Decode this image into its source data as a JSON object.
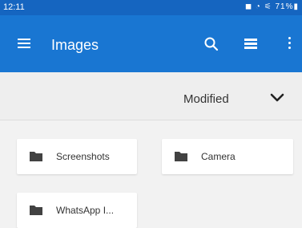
{
  "status_bar": {
    "time": "12:11",
    "icons_text": "◼ ◔ ⚟ 71%▮"
  },
  "app_bar": {
    "title": "Images",
    "menu_icon": "hamburger-menu-icon",
    "search_icon": "search-icon",
    "view_icon": "list-view-icon",
    "overflow_icon": "more-vert-icon"
  },
  "sort": {
    "label": "Modified"
  },
  "folders": [
    {
      "name": "Screenshots"
    },
    {
      "name": "Camera"
    },
    {
      "name": "WhatsApp I..."
    }
  ],
  "colors": {
    "status_bar": "#1565c0",
    "app_bar": "#1976d2",
    "folder_icon": "#424242"
  }
}
